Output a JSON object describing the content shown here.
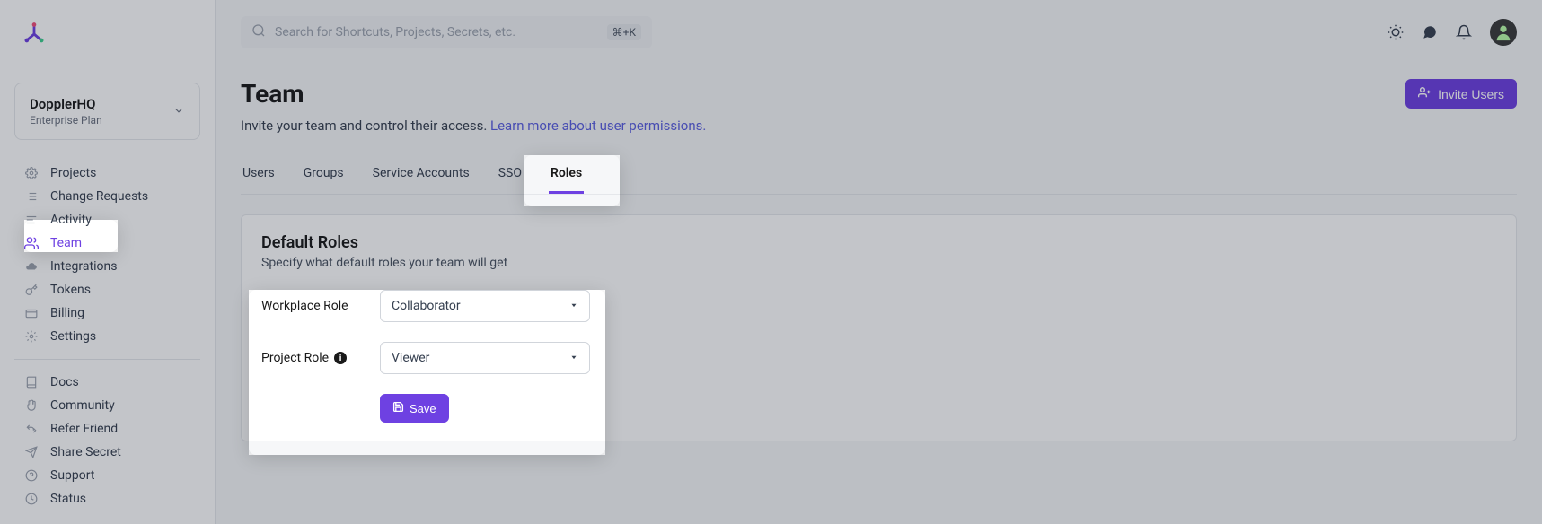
{
  "org": {
    "name": "DopplerHQ",
    "plan": "Enterprise Plan"
  },
  "search": {
    "placeholder": "Search for Shortcuts, Projects, Secrets, etc.",
    "kbd": "⌘+K"
  },
  "header": {
    "title": "Team",
    "invite_label": "Invite Users",
    "subtitle_prefix": "Invite your team and control their access. ",
    "subtitle_link": "Learn more about user permissions."
  },
  "tabs": [
    "Users",
    "Groups",
    "Service Accounts",
    "SSO",
    "Roles"
  ],
  "active_tab": "Roles",
  "sidebar": {
    "primary": [
      "Projects",
      "Change Requests",
      "Activity",
      "Team",
      "Integrations",
      "Tokens",
      "Billing",
      "Settings"
    ],
    "secondary": [
      "Docs",
      "Community",
      "Refer Friend",
      "Share Secret",
      "Support",
      "Status"
    ]
  },
  "panel": {
    "title": "Default Roles",
    "subtitle": "Specify what default roles your team will get",
    "workplace_label": "Workplace Role",
    "workplace_value": "Collaborator",
    "project_label": "Project Role",
    "project_value": "Viewer",
    "save_label": "Save"
  }
}
